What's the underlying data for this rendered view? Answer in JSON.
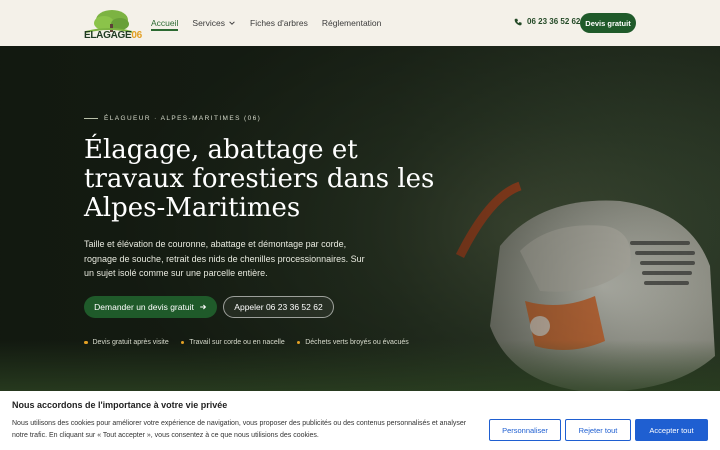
{
  "brand": {
    "logo_text_main": "ELAGAGE",
    "logo_text_num": "06",
    "accent_color": "#1f5a2a",
    "highlight_color": "#e3a024"
  },
  "nav": {
    "items": [
      {
        "label": "Accueil",
        "active": true
      },
      {
        "label": "Services",
        "has_dropdown": true
      },
      {
        "label": "Fiches d'arbres"
      },
      {
        "label": "Réglementation"
      }
    ]
  },
  "header": {
    "phone": "06 23 36 52 62",
    "cta": "Devis gratuit"
  },
  "hero": {
    "kicker": "Élagueur · Alpes-Maritimes (06)",
    "title": "Élagage, abattage et travaux forestiers dans les Alpes-Maritimes",
    "lead": "Taille et élévation de couronne, abattage et démontage par corde, rognage de souche, retrait des nids de chenilles processionnaires. Sur un sujet isolé comme sur une parcelle entière.",
    "primary_button": "Demander un devis gratuit",
    "secondary_button": "Appeler 06 23 36 52 62",
    "points": [
      "Devis gratuit après visite",
      "Travail sur corde ou en nacelle",
      "Déchets verts broyés ou évacués"
    ]
  },
  "cookie": {
    "title": "Nous accordons de l'importance à votre vie privée",
    "text": "Nous utilisons des cookies pour améliorer votre expérience de navigation, vous proposer des publicités ou des contenus personnalisés et analyser notre trafic. En cliquant sur « Tout accepter », vous consentez à ce que nous utilisions des cookies.",
    "btn_customize": "Personnaliser",
    "btn_reject": "Rejeter tout",
    "btn_accept": "Accepter tout"
  }
}
